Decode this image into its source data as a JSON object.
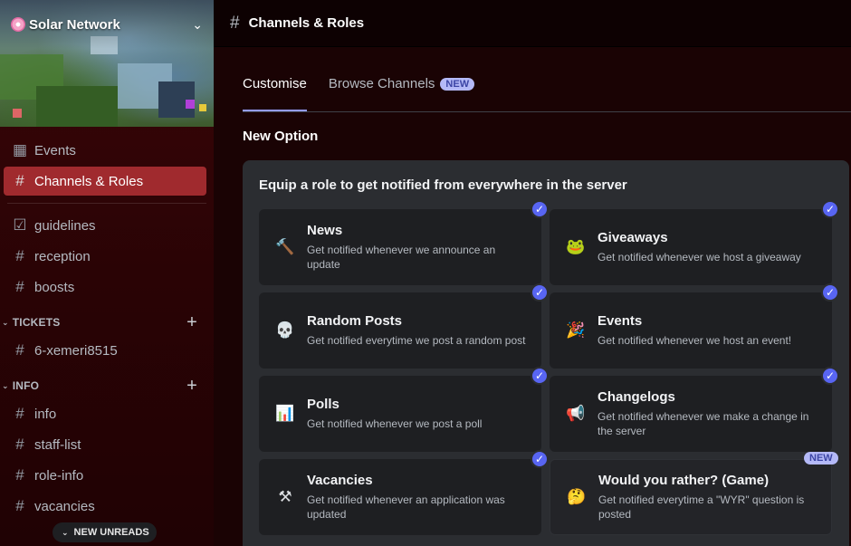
{
  "server": {
    "name": "Solar Network"
  },
  "sidebar": {
    "top_items": [
      {
        "label": "Events",
        "icon": "calendar-icon"
      },
      {
        "label": "Channels & Roles",
        "icon": "channels-browse-icon",
        "active": true
      }
    ],
    "channels": [
      {
        "label": "guidelines",
        "icon": "rules-checkbox-icon"
      },
      {
        "label": "reception",
        "icon": "hashtag-icon"
      },
      {
        "label": "boosts",
        "icon": "hashtag-icon"
      }
    ],
    "categories": [
      {
        "label": "TICKETS",
        "channels": [
          {
            "label": "6-xemeri8515"
          }
        ]
      },
      {
        "label": "INFO",
        "channels": [
          {
            "label": "info"
          },
          {
            "label": "staff-list"
          },
          {
            "label": "role-info"
          },
          {
            "label": "vacancies"
          }
        ]
      }
    ],
    "new_unreads": "NEW UNREADS"
  },
  "header": {
    "title": "Channels & Roles"
  },
  "tabs": [
    {
      "label": "Customise",
      "active": true
    },
    {
      "label": "Browse Channels",
      "badge": "NEW"
    }
  ],
  "section": {
    "title": "New Option"
  },
  "panel": {
    "title": "Equip a role to get notified from everywhere in the server",
    "options": [
      {
        "name": "News",
        "desc": "Get notified whenever we announce an update",
        "emoji": "🔨",
        "selected": true
      },
      {
        "name": "Giveaways",
        "desc": "Get notified whenever we host a giveaway",
        "emoji": "🐸",
        "selected": true
      },
      {
        "name": "Random Posts",
        "desc": "Get notified everytime we post a random post",
        "emoji": "💀",
        "selected": true
      },
      {
        "name": "Events",
        "desc": "Get notified whenever we host an event!",
        "emoji": "🎉",
        "selected": true
      },
      {
        "name": "Polls",
        "desc": "Get notified whenever we post a poll",
        "emoji": "📊",
        "selected": true
      },
      {
        "name": "Changelogs",
        "desc": "Get notified whenever we make a change in the server",
        "emoji": "📢",
        "selected": true
      },
      {
        "name": "Vacancies",
        "desc": "Get notified whenever an application was updated",
        "emoji": "⚒",
        "selected": true
      },
      {
        "name": "Would you rather? (Game)",
        "desc": "Get notified everytime a \"WYR\" question is posted",
        "emoji": "🤔",
        "selected": false,
        "badge": "NEW"
      }
    ]
  },
  "check_glyph": "✓",
  "colors": {
    "accent": "#5865f2",
    "active_channel": "#a02a2e",
    "badge_bg": "#b4b9f7"
  }
}
